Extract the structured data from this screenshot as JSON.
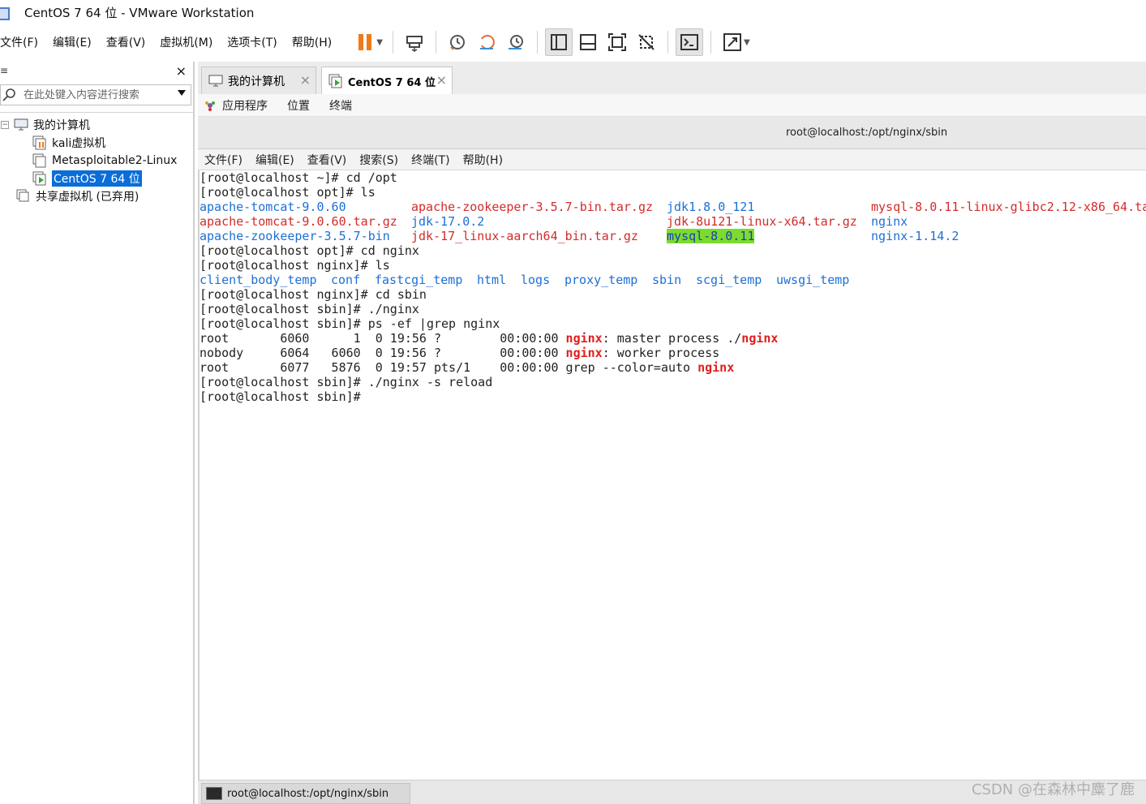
{
  "window": {
    "title": "CentOS 7 64 位 - VMware Workstation"
  },
  "menubar": {
    "items": [
      "文件(F)",
      "编辑(E)",
      "查看(V)",
      "虚拟机(M)",
      "选项卡(T)",
      "帮助(H)"
    ]
  },
  "toolbar": {
    "icons": [
      "pause-icon",
      "send-ctrl-alt-del-icon",
      "snapshot-icon",
      "revert-snapshot-icon",
      "snapshot-manager-icon",
      "show-library-icon",
      "thumbnail-icon",
      "fullscreen-icon",
      "unity-icon",
      "console-view-icon",
      "stretch-icon"
    ],
    "accent": "#f07a1a"
  },
  "library": {
    "search_placeholder": "在此处键入内容进行搜索",
    "close": "×",
    "tree": {
      "root_label": "我的计算机",
      "vms": [
        "kali虚拟机",
        "Metasploitable2-Linux",
        "CentOS 7 64 位"
      ],
      "shared_label": "共享虚拟机 (已弃用)",
      "selected": "CentOS 7 64 位"
    }
  },
  "tabs": {
    "home_label": "我的计算机",
    "vm_label": "CentOS 7 64 位",
    "close": "×"
  },
  "gnome": {
    "menu": [
      "应用程序",
      "位置",
      "终端"
    ]
  },
  "terminal": {
    "title": "root@localhost:/opt/nginx/sbin",
    "menu": [
      "文件(F)",
      "编辑(E)",
      "查看(V)",
      "搜索(S)",
      "终端(T)",
      "帮助(H)"
    ],
    "lines": {
      "l1": "[root@localhost ~]# cd /opt",
      "l2": "[root@localhost opt]# ls",
      "l3": "[root@localhost opt]# cd nginx",
      "l4": "[root@localhost nginx]# ls",
      "l5": "[root@localhost nginx]# cd sbin",
      "l6": "[root@localhost sbin]# ./nginx",
      "l7": "[root@localhost sbin]# ps -ef |grep nginx",
      "l8": "[root@localhost sbin]# ./nginx -s reload",
      "l9": "[root@localhost sbin]# "
    },
    "ls_opt": {
      "a1": "apache-tomcat-9.0.60",
      "a2": "apache-tomcat-9.0.60.tar.gz",
      "a3": "apache-zookeeper-3.5.7-bin",
      "b1": "apache-zookeeper-3.5.7-bin.tar.gz",
      "b2": "jdk-17.0.2",
      "b3": "jdk-17_linux-aarch64_bin.tar.gz",
      "c1": "jdk1.8.0_121",
      "c2": "jdk-8u121-linux-x64.tar.gz",
      "c3": "mysql-8.0.11",
      "d1": "mysql-8.0.11-linux-glibc2.12-x86_64.ta",
      "d2": "nginx",
      "d3": "nginx-1.14.2"
    },
    "ls_nginx": [
      "client_body_temp",
      "conf",
      "fastcgi_temp",
      "html",
      "logs",
      "proxy_temp",
      "sbin",
      "scgi_temp",
      "uwsgi_temp"
    ],
    "ps": {
      "r1_pre": "root       6060      1  0 19:56 ?        00:00:00 ",
      "r1_kw": "nginx",
      "r1_mid": ": master process ./",
      "r1_kw2": "nginx",
      "r2_pre": "nobody     6064   6060  0 19:56 ?        00:00:00 ",
      "r2_kw": "nginx",
      "r2_post": ": worker process",
      "r3_pre": "root       6077   5876  0 19:57 pts/1    00:00:00 grep --color=auto ",
      "r3_kw": "nginx"
    },
    "colors": {
      "dir": "#1d6fd6",
      "archive": "#d32b2b",
      "highlight": "#7bdc2e",
      "match": "#e01f1f"
    }
  },
  "taskbar": {
    "item_label": "root@localhost:/opt/nginx/sbin"
  },
  "watermark": "CSDN @在森林中麋了鹿"
}
